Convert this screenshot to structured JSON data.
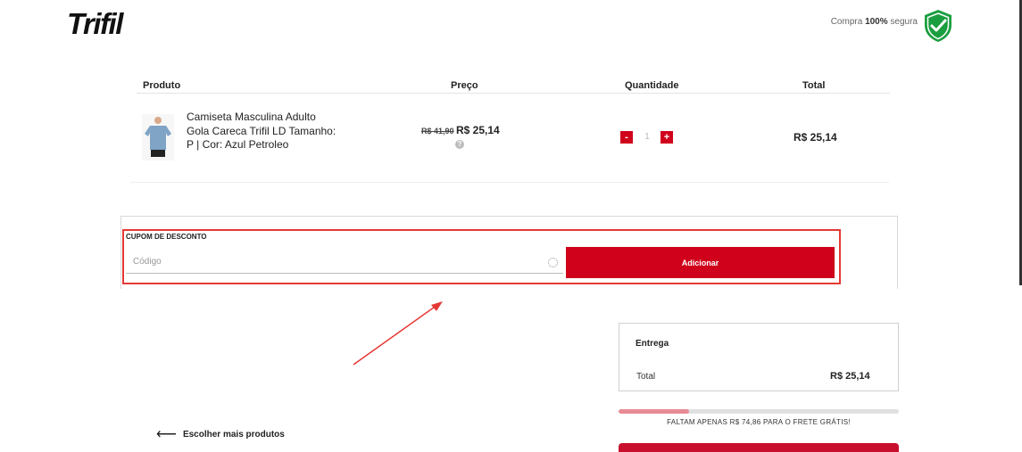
{
  "header": {
    "logo": "Trifil",
    "secure_prefix": "Compra",
    "secure_bold": "100%",
    "secure_suffix": "segura",
    "shield_icon": "shield-check-icon",
    "shield_color": "#1a9e3f"
  },
  "cart": {
    "columns": [
      "Produto",
      "Preço",
      "Quantidade",
      "Total"
    ],
    "items": [
      {
        "name": "Camiseta Masculina Adulto Gola Careca Trifil LD Tamanho: P | Cor: Azul Petroleo",
        "old_price": "R$ 41,90",
        "price": "R$ 25,14",
        "quantity": "1",
        "minus": "-",
        "plus": "+",
        "total": "R$ 25,14"
      }
    ]
  },
  "coupon": {
    "label": "CUPOM DE DESCONTO",
    "placeholder": "Código",
    "button": "Adicionar"
  },
  "summary": {
    "title": "Entrega",
    "total_label": "Total",
    "total_value": "R$ 25,14"
  },
  "shipping": {
    "progress": 0.25,
    "message": "FALTAM APENAS R$ 74,86 PARA O FRETE GRÁTIS!"
  },
  "back_link": "Escolher mais produtos",
  "colors": {
    "brand_red": "#d0021b",
    "highlight": "#e53935",
    "progress_fill": "#e88a93"
  }
}
